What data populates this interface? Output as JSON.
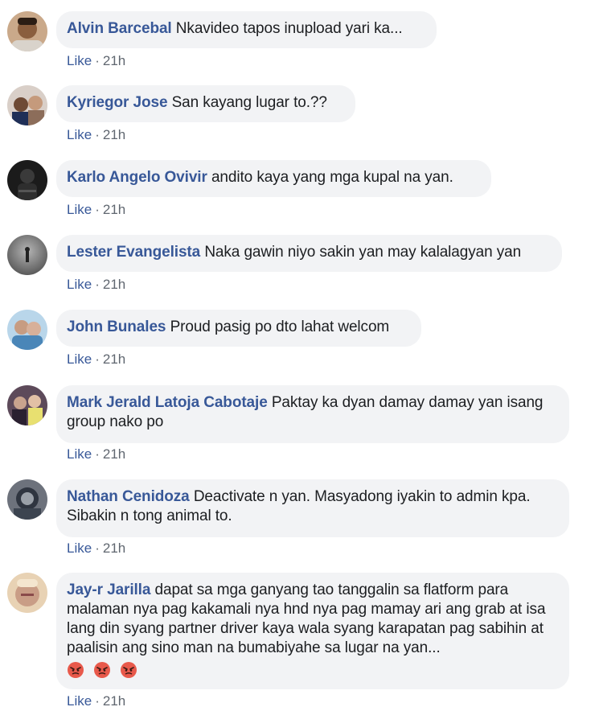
{
  "comments": [
    {
      "author": "Alvin Barcebal",
      "text": "Nkavideo tapos inupload yari ka...",
      "like_label": "Like",
      "separator": "·",
      "time": "21h",
      "avatar_color": "#a57b5a"
    },
    {
      "author": "Kyriegor Jose",
      "text": "San kayang lugar to.??",
      "like_label": "Like",
      "separator": "·",
      "time": "21h",
      "avatar_color": "#3b4a6b"
    },
    {
      "author": "Karlo Angelo Ovivir",
      "text": "andito kaya yang mga kupal na yan.",
      "like_label": "Like",
      "separator": "·",
      "time": "21h",
      "avatar_color": "#2a2a2a"
    },
    {
      "author": "Lester Evangelista",
      "text": "Naka gawin niyo sakin yan may kalalagyan yan",
      "like_label": "Like",
      "separator": "·",
      "time": "21h",
      "avatar_color": "#8d8d8d"
    },
    {
      "author": "John Bunales",
      "text": "Proud pasig po dto lahat welcom",
      "like_label": "Like",
      "separator": "·",
      "time": "21h",
      "avatar_color": "#6ba3c8"
    },
    {
      "author": "Mark Jerald Latoja Cabotaje",
      "text": "Paktay ka dyan damay damay yan isang group nako po",
      "like_label": "Like",
      "separator": "·",
      "time": "21h",
      "avatar_color": "#5a4b5e"
    },
    {
      "author": "Nathan Cenidoza",
      "text": "Deactivate n yan. Masyadong iyakin to admin kpa. Sibakin n tong animal to.",
      "like_label": "Like",
      "separator": "·",
      "time": "21h",
      "avatar_color": "#4d5563"
    },
    {
      "author": "Jay-r Jarilla",
      "text": "dapat sa mga ganyang tao tanggalin sa flatform para malaman nya pag kakamali nya hnd nya pag mamay ari ang grab at isa lang din syang partner driver kaya wala syang karapatan pag sabihin at paalisin ang sino man na bumabiyahe sa lugar na yan...",
      "like_label": "Like",
      "separator": "·",
      "time": "21h",
      "avatar_color": "#d9b28c",
      "emojis": [
        "angry-face-emoji",
        "angry-face-emoji",
        "angry-face-emoji"
      ]
    }
  ]
}
